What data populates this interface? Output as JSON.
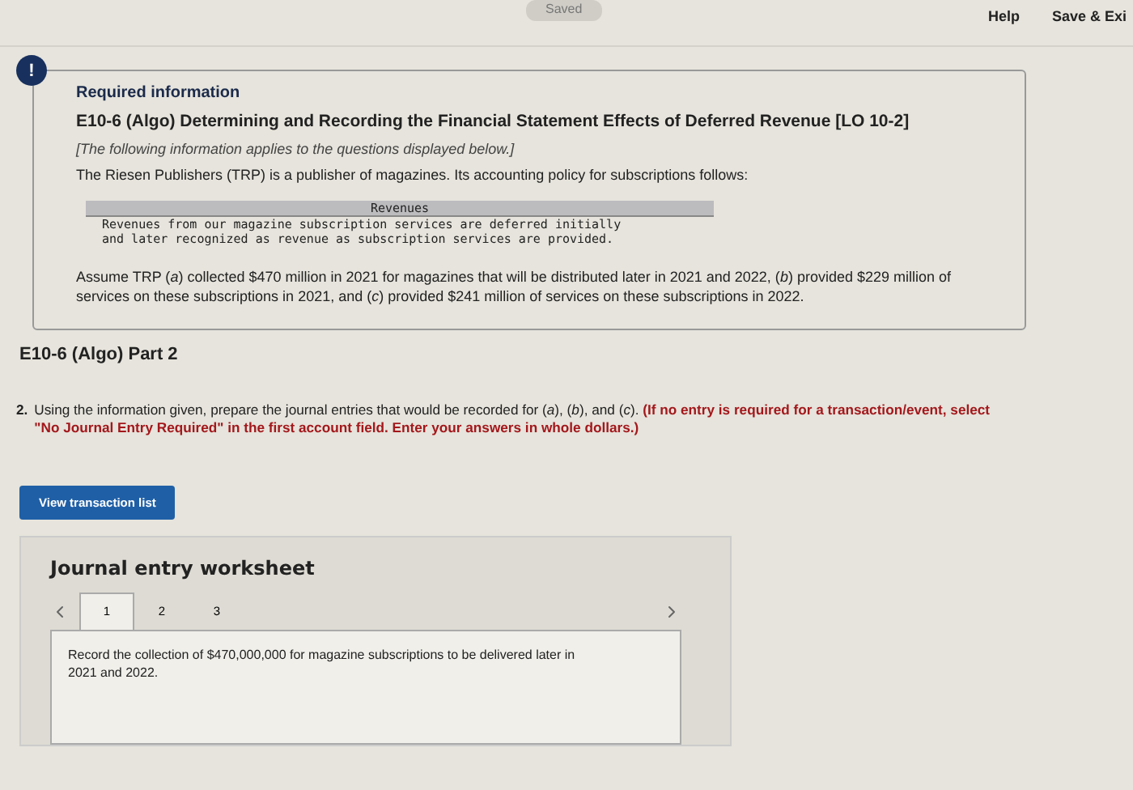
{
  "top_bar": {
    "status": "Saved",
    "links": [
      "Help",
      "Save & Exi"
    ]
  },
  "info_card": {
    "alert_mark": "!",
    "heading": "Required information",
    "title": "E10-6 (Algo) Determining and Recording the Financial Statement Effects of Deferred Revenue [LO 10-2]",
    "note": "[The following information applies to the questions displayed below.]",
    "intro": "The Riesen Publishers (TRP) is a publisher of magazines. Its accounting policy for subscriptions follows:",
    "policy": {
      "header": "Revenues",
      "lines": [
        "Revenues from our magazine subscription services are deferred initially",
        "and later recognized as revenue as subscription services are provided."
      ]
    },
    "assumption": "Assume TRP (*a*) collected $470 million in 2021 for magazines that will be distributed later in 2021 and 2022, (*b*) provided $229 million of services on these subscriptions in 2021, and (*c*) provided $241 million of services on these subscriptions in 2022."
  },
  "part_title": "E10-6 (Algo) Part 2",
  "question": {
    "number": "2.",
    "text": "Using the information given, prepare the journal entries that would be recorded for (*a*), (*b*), and (*c*). **(If no entry is required for a transaction/event, select \"No Journal Entry Required\" in the first account field. Enter your answers in whole dollars.)**"
  },
  "view_button": "View transaction list",
  "worksheet": {
    "title": "Journal entry worksheet",
    "tabs": [
      {
        "label": "1",
        "selected": true
      },
      {
        "label": "2",
        "selected": false
      },
      {
        "label": "3",
        "selected": false
      }
    ],
    "instruction": "Record the collection of $470,000,000 for magazine subscriptions to be delivered later in 2021 and 2022."
  }
}
